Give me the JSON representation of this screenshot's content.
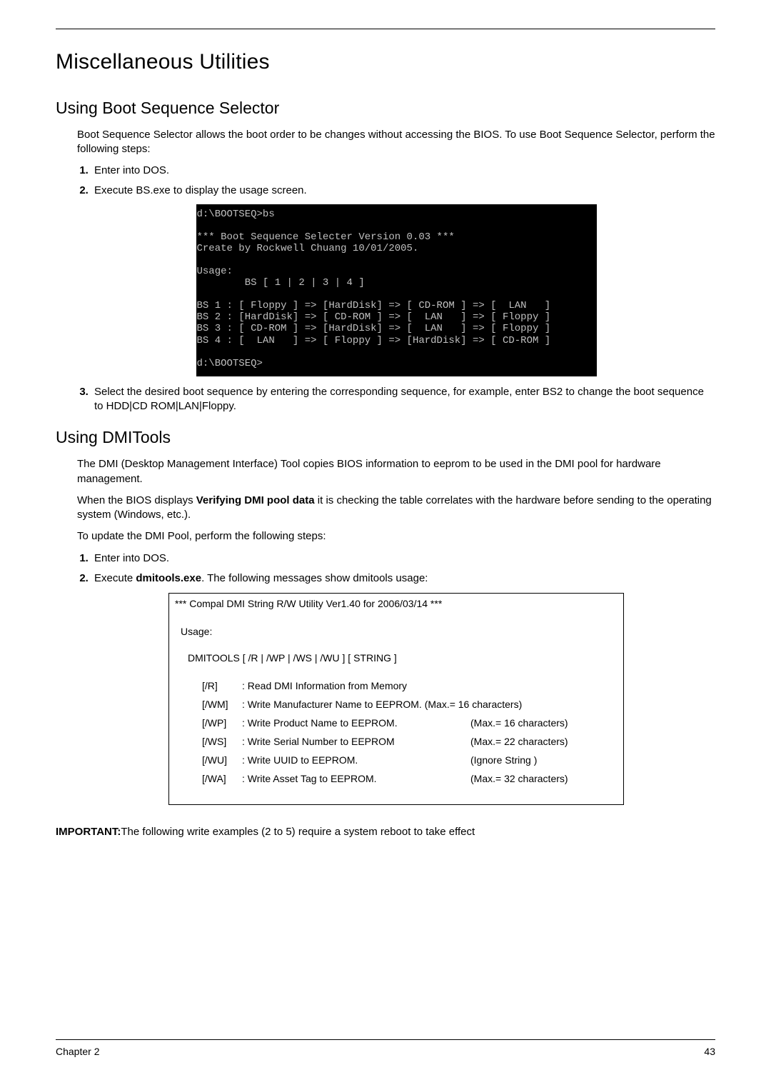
{
  "header": {
    "rule": true
  },
  "title": "Miscellaneous Utilities",
  "section1": {
    "heading": "Using Boot Sequence Selector",
    "intro": "Boot Sequence Selector allows the boot order to be changes without accessing the BIOS. To use Boot Sequence Selector, perform the following steps:",
    "steps": [
      "Enter into DOS.",
      "Execute BS.exe to display the usage screen."
    ],
    "dos": "d:\\BOOTSEQ>bs\n\n*** Boot Sequence Selecter Version 0.03 ***\nCreate by Rockwell Chuang 10/01/2005.\n\nUsage:\n        BS [ 1 | 2 | 3 | 4 ]\n\nBS 1 : [ Floppy ] => [HardDisk] => [ CD-ROM ] => [  LAN   ]\nBS 2 : [HardDisk] => [ CD-ROM ] => [  LAN   ] => [ Floppy ]\nBS 3 : [ CD-ROM ] => [HardDisk] => [  LAN   ] => [ Floppy ]\nBS 4 : [  LAN   ] => [ Floppy ] => [HardDisk] => [ CD-ROM ]\n\nd:\\BOOTSEQ>",
    "step3": "Select the desired boot sequence by entering the corresponding sequence, for example, enter BS2 to change the boot sequence to HDD|CD ROM|LAN|Floppy."
  },
  "section2": {
    "heading": "Using DMITools",
    "intro1": "The DMI (Desktop Management Interface) Tool copies BIOS information to eeprom to be used in the DMI pool for hardware management.",
    "intro2a": "When the BIOS displays ",
    "intro2bold": "Verifying DMI pool data",
    "intro2b": " it is checking the table correlates with the hardware before sending to the operating system (Windows, etc.).",
    "intro3": "To update the DMI Pool, perform the following steps:",
    "steps": {
      "s1": "Enter into DOS.",
      "s2a": "Execute ",
      "s2bold": "dmitools.exe",
      "s2b": ". The following messages show dmitools usage:"
    },
    "dmi": {
      "header": "*** Compal DMI String R/W Utility Ver1.40 for 2006/03/14 ***",
      "usage": "Usage:",
      "cmd": "DMITOOLS [ /R | /WP | /WS | /WU ] [ STRING ]",
      "rows": [
        {
          "flag": "[/R]",
          "desc": ": Read DMI Information from Memory",
          "max": ""
        },
        {
          "flag": "[/WM]",
          "desc": ": Write Manufacturer Name to EEPROM. (Max.= 16 characters)",
          "max": ""
        },
        {
          "flag": "[/WP]",
          "desc": ": Write Product Name to EEPROM.",
          "max": "(Max.= 16 characters)"
        },
        {
          "flag": "[/WS]",
          "desc": ": Write Serial Number to EEPROM",
          "max": "(Max.= 22 characters)"
        },
        {
          "flag": "[/WU]",
          "desc": ": Write UUID to EEPROM.",
          "max": "(Ignore String          )"
        },
        {
          "flag": "[/WA]",
          "desc": ": Write Asset Tag to EEPROM.",
          "max": "(Max.= 32 characters)"
        }
      ]
    },
    "important_label": "IMPORTANT:",
    "important_text": "The following write examples (2 to 5) require a system reboot to take effect"
  },
  "footer": {
    "left": "Chapter 2",
    "right": "43"
  }
}
